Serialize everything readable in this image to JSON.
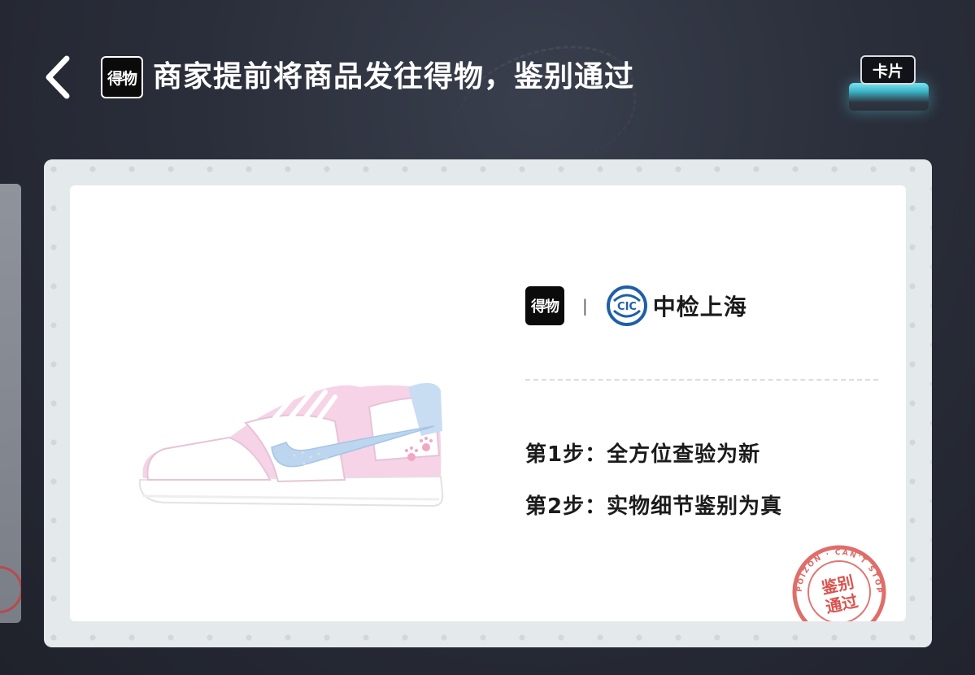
{
  "header": {
    "back_icon": "chevron-left-icon",
    "logo_text": "得物",
    "title": "商家提前将商品发往得物，鉴别通过",
    "card_button_label": "卡片"
  },
  "certificate": {
    "partner_logo_text": "得物",
    "separator": "|",
    "inspector_logo_text": "CIC",
    "inspector_name": "中检上海",
    "steps": [
      "第1步：全方位查验为新",
      "第2步：实物细节鉴别为真"
    ],
    "seal_text": "鉴别通过",
    "seal_ring_text": "POIZON · CAN'T STOP"
  },
  "colors": {
    "background": "#2a2e3a",
    "card_border": "#e4e9ec",
    "seal_red": "#d9534f",
    "inspector_blue": "#1f5fa8"
  }
}
